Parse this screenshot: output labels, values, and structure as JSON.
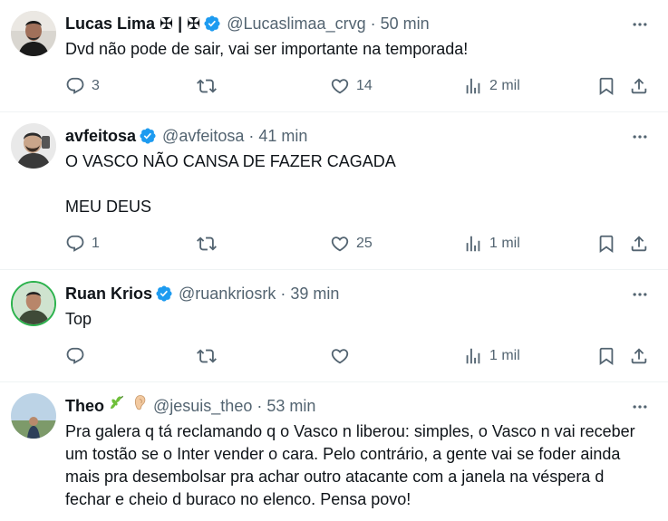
{
  "tweets": [
    {
      "name": "Lucas Lima ✠ | ✠",
      "handle": "@Lucaslimaa_crvg",
      "dot": "·",
      "time": "50 min",
      "text": "Dvd não pode de sair, vai ser importante na temporada!",
      "replies": "3",
      "retweets": "",
      "likes": "14",
      "views": "2 mil",
      "verified": true
    },
    {
      "name": "avfeitosa",
      "handle": "@avfeitosa",
      "dot": "·",
      "time": "41 min",
      "text": "O VASCO NÃO CANSA DE FAZER CAGADA\n\nMEU DEUS",
      "replies": "1",
      "retweets": "",
      "likes": "25",
      "views": "1 mil",
      "verified": true
    },
    {
      "name": "Ruan Krios",
      "handle": "@ruankriosrk",
      "dot": "·",
      "time": "39 min",
      "text": "Top",
      "replies": "",
      "retweets": "",
      "likes": "",
      "views": "1 mil",
      "verified": true
    },
    {
      "name": "Theo",
      "name_emoji_1": "leaf-emoji",
      "name_emoji_2": "ear-emoji",
      "handle": "@jesuis_theo",
      "dot": "·",
      "time": "53 min",
      "text": "Pra galera q tá reclamando q o Vasco n liberou: simples, o Vasco n vai receber um tostão se o Inter vender o cara. Pelo contrário, a gente vai se foder ainda mais pra desembolsar pra achar outro atacante com a janela na véspera d fechar e cheio d buraco no elenco. Pensa povo!",
      "verified": false
    }
  ],
  "colors": {
    "text": "#0f1419",
    "secondary": "#536471",
    "verified": "#1d9bf0",
    "divider": "#eff3f4"
  }
}
